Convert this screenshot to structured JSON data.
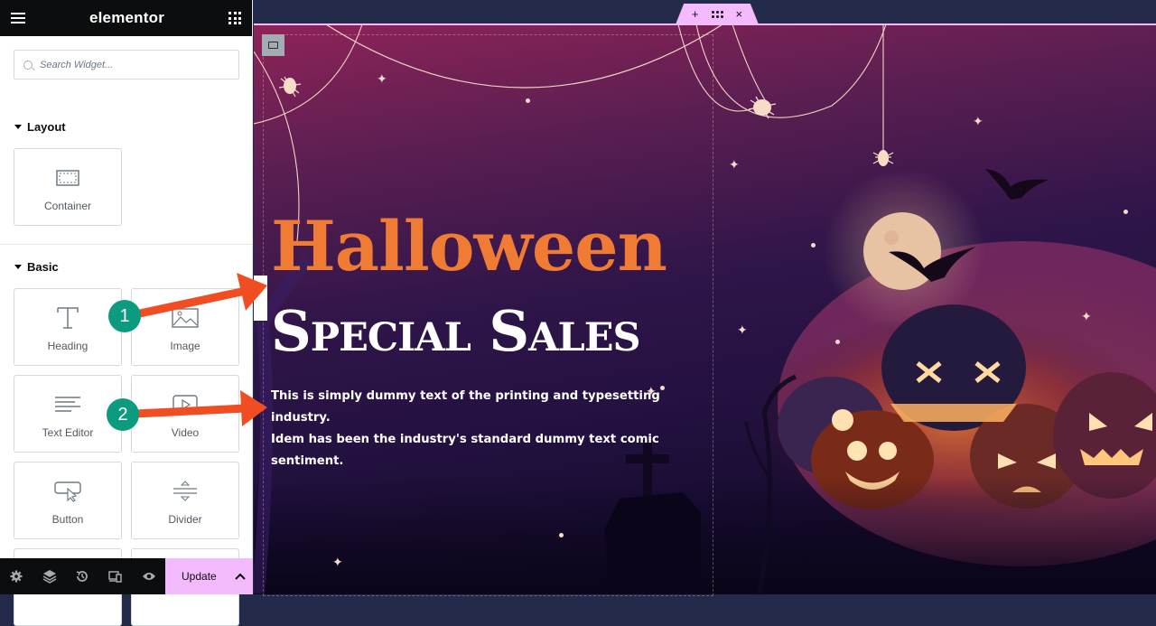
{
  "app": {
    "logo": "elementor"
  },
  "search": {
    "placeholder": "Search Widget..."
  },
  "sections": {
    "layout": {
      "title": "Layout",
      "widgets": [
        {
          "label": "Container",
          "icon": "container-icon"
        }
      ]
    },
    "basic": {
      "title": "Basic",
      "widgets": [
        {
          "label": "Heading",
          "icon": "heading-icon"
        },
        {
          "label": "Image",
          "icon": "image-icon"
        },
        {
          "label": "Text Editor",
          "icon": "text-editor-icon"
        },
        {
          "label": "Video",
          "icon": "video-icon"
        },
        {
          "label": "Button",
          "icon": "button-icon"
        },
        {
          "label": "Divider",
          "icon": "divider-icon"
        }
      ]
    }
  },
  "footer": {
    "icons": [
      "settings-icon",
      "layers-icon",
      "history-icon",
      "responsive-icon",
      "preview-icon"
    ],
    "update_label": "Update"
  },
  "canvas": {
    "handle": {
      "add": "+",
      "close": "×"
    },
    "heading": "Halloween",
    "subheading": "Special Sales",
    "body_line1": "This is simply dummy text of the printing and typesetting industry.",
    "body_line2": "Idem has been the industry's standard dummy text comic sentiment."
  },
  "annotations": [
    {
      "number": "1"
    },
    {
      "number": "2"
    }
  ],
  "colors": {
    "accent": "#f3bafd",
    "heading": "#f07b34",
    "arrow": "#f04d23",
    "badge": "#0d9b80"
  }
}
